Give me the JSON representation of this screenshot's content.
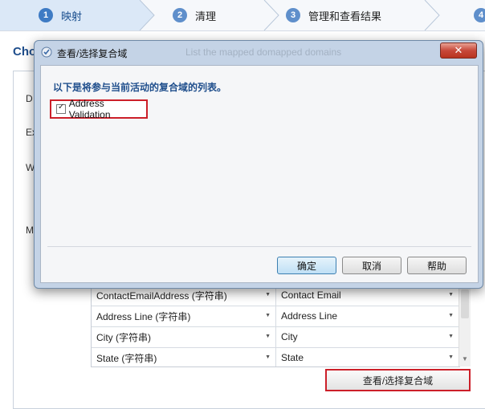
{
  "wizard": {
    "steps": [
      {
        "num": "1",
        "label": "映射"
      },
      {
        "num": "2",
        "label": "清理"
      },
      {
        "num": "3",
        "label": "管理和查看结果"
      },
      {
        "num": "4",
        "label": ""
      }
    ]
  },
  "background": {
    "title": "Cho",
    "labels": [
      "D",
      "Ex",
      "W",
      "M"
    ]
  },
  "mapping_grid": {
    "rows": [
      {
        "input": "ContactEmailAddress (字符串)",
        "domain": "Contact Email"
      },
      {
        "input": "Address Line (字符串)",
        "domain": "Address Line"
      },
      {
        "input": "City (字符串)",
        "domain": "City"
      },
      {
        "input": "State (字符串)",
        "domain": "State"
      }
    ],
    "dropdown_glyph": "▼",
    "scroll_down_glyph": "▼"
  },
  "view_select_button": "查看/选择复合域",
  "dialog": {
    "title": "查看/选择复合域",
    "ghost_title": "List the mapped domapped domains",
    "close_glyph": "✕",
    "heading": "以下是将参与当前活动的复合域的列表。",
    "composite_domains": [
      {
        "label": "Address Validation",
        "checked": true,
        "check_glyph": "✓"
      }
    ],
    "buttons": {
      "ok": "确定",
      "cancel": "取消",
      "help": "帮助"
    }
  },
  "colors": {
    "accent": "#1f4e8c",
    "highlight_border": "#cc1f29",
    "dialog_frame": "#c4d3e6"
  }
}
